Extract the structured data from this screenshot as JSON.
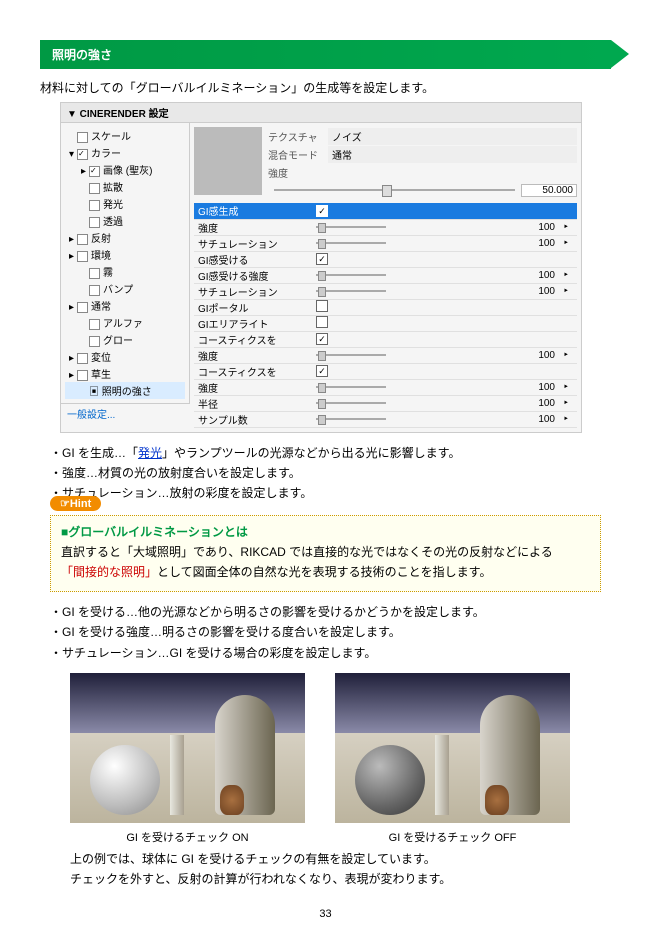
{
  "section_title": "照明の強さ",
  "intro": "材料に対しての「グローバルイルミネーション」の生成等を設定します。",
  "dialog": {
    "title": "▼ CINERENDER 設定",
    "tree": [
      {
        "lvl": 1,
        "caret": "",
        "cb": false,
        "label": "スケール"
      },
      {
        "lvl": 1,
        "caret": "▾",
        "cb": true,
        "label": "カラー",
        "checked": true
      },
      {
        "lvl": 2,
        "caret": "▸",
        "cb": true,
        "label": "画像 (聖灰)",
        "checked": true
      },
      {
        "lvl": 2,
        "caret": "",
        "cb": false,
        "label": "拡散"
      },
      {
        "lvl": 2,
        "caret": "",
        "cb": false,
        "label": "発光"
      },
      {
        "lvl": 2,
        "caret": "",
        "cb": false,
        "label": "透過"
      },
      {
        "lvl": 1,
        "caret": "▸",
        "cb": false,
        "label": "反射"
      },
      {
        "lvl": 1,
        "caret": "▸",
        "cb": false,
        "label": "環境"
      },
      {
        "lvl": 2,
        "caret": "",
        "cb": false,
        "label": "霧"
      },
      {
        "lvl": 2,
        "caret": "",
        "cb": false,
        "label": "バンプ"
      },
      {
        "lvl": 1,
        "caret": "▸",
        "cb": false,
        "label": "通常"
      },
      {
        "lvl": 2,
        "caret": "",
        "cb": false,
        "label": "アルファ"
      },
      {
        "lvl": 2,
        "caret": "",
        "cb": false,
        "label": "グロー"
      },
      {
        "lvl": 1,
        "caret": "▸",
        "cb": false,
        "label": "変位"
      },
      {
        "lvl": 1,
        "caret": "▸",
        "cb": false,
        "label": "草生"
      },
      {
        "lvl": 2,
        "caret": "",
        "cb": null,
        "label": "照明の強さ",
        "selected": true,
        "icon": "doc"
      }
    ],
    "tree_footer": "一般設定...",
    "preview": {
      "texture_label": "テクスチャ",
      "texture_value": "ノイズ",
      "blend_label": "混合モード",
      "blend_value": "通常",
      "strength_label": "強度",
      "strength_value": "50.000"
    },
    "params": [
      {
        "label": "GI感生成",
        "type": "check",
        "checked": true,
        "hl": true
      },
      {
        "label": "強度",
        "type": "slider",
        "value": "100"
      },
      {
        "label": "サチュレーション",
        "type": "slider",
        "value": "100"
      },
      {
        "label": "GI感受ける",
        "type": "check",
        "checked": true
      },
      {
        "label": "GI感受ける強度",
        "type": "slider",
        "value": "100"
      },
      {
        "label": "サチュレーション",
        "type": "slider",
        "value": "100"
      },
      {
        "label": "GIポータル",
        "type": "check",
        "checked": false
      },
      {
        "label": "GIエリアライト",
        "type": "check",
        "checked": false
      },
      {
        "label": "コースティクスを",
        "type": "check",
        "checked": true
      },
      {
        "label": "強度",
        "type": "slider",
        "value": "100"
      },
      {
        "label": "コースティクスを",
        "type": "check",
        "checked": true
      },
      {
        "label": "強度",
        "type": "slider",
        "value": "100"
      },
      {
        "label": "半径",
        "type": "slider",
        "value": "100"
      },
      {
        "label": "サンプル数",
        "type": "slider",
        "value": "100"
      }
    ]
  },
  "bullets1": {
    "b1_pre": "・GI を生成…「",
    "b1_link": "発光",
    "b1_post": "」やランプツールの光源などから出る光に影響します。",
    "b2": "・強度…材質の光の放射度合いを設定します。",
    "b3": "・サチュレーション…放射の彩度を設定します。"
  },
  "hint": {
    "label": "☞Hint",
    "title": "■グローバルイルミネーションとは",
    "line1_pre": "直訳すると「大域照明」であり、RIKCAD では直接的な光ではなくその光の反射などによる",
    "line2_q": "「間接的な照明」",
    "line2_post": "として図面全体の自然な光を表現する技術のことを指します。"
  },
  "bullets2": {
    "b1": "・GI を受ける…他の光源などから明るさの影響を受けるかどうかを設定します。",
    "b2": "・GI を受ける強度…明るさの影響を受ける度合いを設定します。",
    "b3": "・サチュレーション…GI を受ける場合の彩度を設定します。"
  },
  "captions": {
    "left": "GI を受けるチェック ON",
    "right": "GI を受けるチェック OFF"
  },
  "conclusion": {
    "l1": "上の例では、球体に GI を受けるチェックの有無を設定しています。",
    "l2": "チェックを外すと、反射の計算が行われなくなり、表現が変わります。"
  },
  "page_number": "33"
}
